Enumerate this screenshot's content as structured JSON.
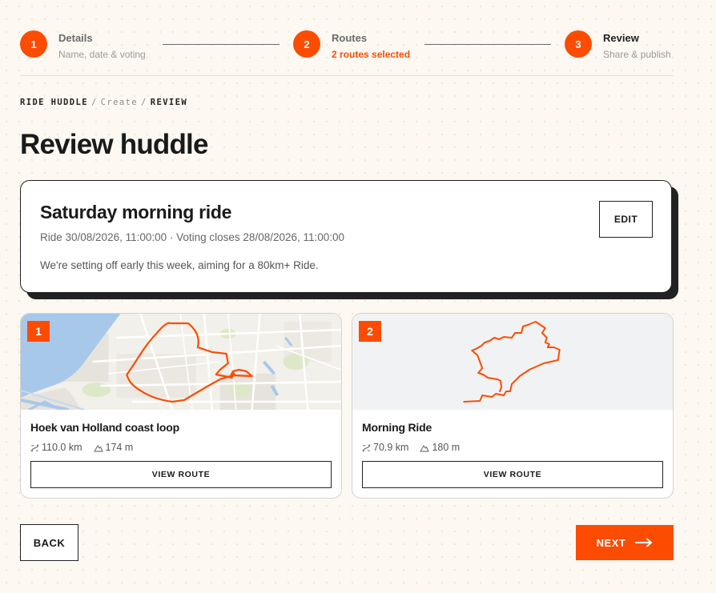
{
  "stepper": {
    "steps": [
      {
        "number": "1",
        "title": "Details",
        "subtitle": "Name, date & voting"
      },
      {
        "number": "2",
        "title": "Routes",
        "subtitle": "2 routes selected"
      },
      {
        "number": "3",
        "title": "Review",
        "subtitle": "Share & publish"
      }
    ]
  },
  "breadcrumb": {
    "root": "RIDE HUDDLE",
    "middle": "Create",
    "current": "REVIEW",
    "separator": "/"
  },
  "page_title": "Review huddle",
  "summary": {
    "title": "Saturday morning ride",
    "meta": "Ride 30/08/2026, 11:00:00 · Voting closes 28/08/2026, 11:00:00",
    "description": "We're setting off early this week, aiming for a 80km+ Ride.",
    "edit_label": "EDIT"
  },
  "routes": [
    {
      "badge": "1",
      "name": "Hoek van Holland coast loop",
      "distance": "110.0 km",
      "elevation": "174 m",
      "view_label": "VIEW ROUTE"
    },
    {
      "badge": "2",
      "name": "Morning Ride",
      "distance": "70.9 km",
      "elevation": "180 m",
      "view_label": "VIEW ROUTE"
    }
  ],
  "footer": {
    "back_label": "BACK",
    "next_label": "NEXT"
  },
  "colors": {
    "accent": "#fc4c02",
    "background": "#fdf8f1",
    "text": "#1f1f1f",
    "water": "#a8c8ea",
    "park": "#dde8c9"
  },
  "icons": {
    "distance": "route-distance-icon",
    "elevation": "mountain-icon",
    "next": "arrow-right-icon"
  }
}
